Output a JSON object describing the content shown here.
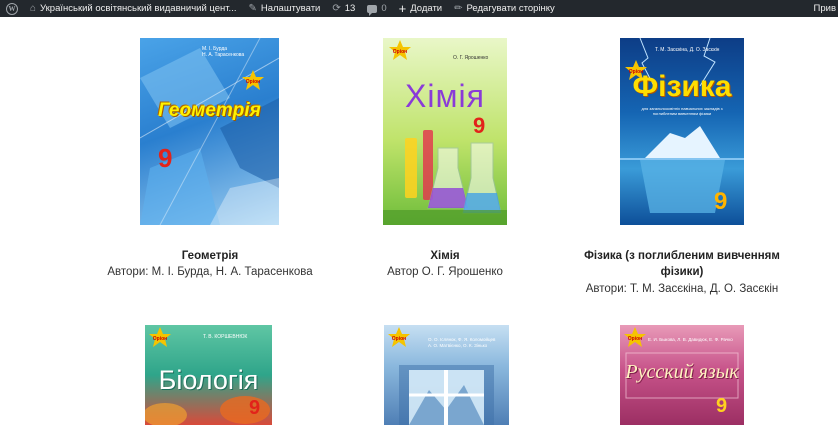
{
  "adminbar": {
    "site_name": "Український освітянський видавничий цент...",
    "customize": "Налаштувати",
    "updates_count": "13",
    "comments_count": "0",
    "add_new": "Додати",
    "edit_page": "Редагувати сторінку",
    "greeting": "Прив"
  },
  "books": [
    {
      "title": "Геометрія",
      "authors": "Автори: М. І. Бурда, Н. А. Тарасенкова",
      "cover_title": "Геометрія",
      "cover_authors": "М. І. Бурда\nН. А. Тарасенкова",
      "grade": "9"
    },
    {
      "title": "Хімія",
      "authors": "Автор О. Г. Ярошенко",
      "cover_title": "Хімія",
      "cover_authors": "О. Г. Ярошенко",
      "grade": "9"
    },
    {
      "title_line1": "Фізика (з поглибленим вивченням",
      "title_line2": "фізики)",
      "authors": "Автори: Т. М. Засєкіна, Д. О. Засєкін",
      "cover_title": "Фізика",
      "cover_authors": "Т. М. Засєкіна, Д. О. Засєкін",
      "cover_subtitle": "для загальноосвітніх навчальних закладів з поглибленим вивченням фізики",
      "grade": "9"
    },
    {
      "cover_title": "Біологія",
      "cover_authors": "Т. В. КОРШЕВНЮК",
      "grade": "9"
    },
    {
      "cover_authors": "О. О. Іслянок, Ф. Я. Коломойцев\nА. О. Матвієнко, О. К. Зінько"
    },
    {
      "cover_title": "Русский язык",
      "cover_authors": "Е. И. Быкова, Л. В. Давидюк, Е. Ф. Рачко",
      "grade": "9"
    }
  ],
  "publisher_badge": "Оріон",
  "colors": {
    "adminbar_bg": "#23282d",
    "geometry_bg": "#2a7fcf",
    "chemistry_bg": "#bfe36a",
    "physics_bg": "#1565b3",
    "biology_bg": "#2fa58a",
    "russian_bg": "#b13a73"
  }
}
